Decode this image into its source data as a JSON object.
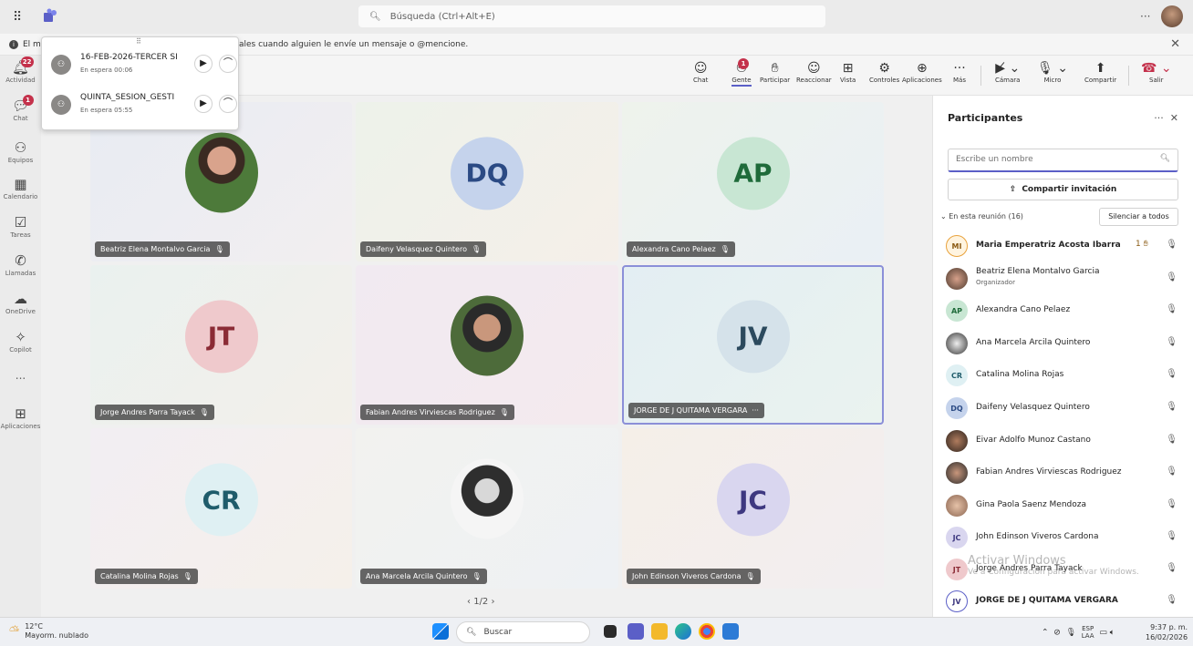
{
  "topbar": {
    "search_placeholder": "Búsqueda (Ctrl+Alt+E)"
  },
  "banner": {
    "text": "El m",
    "text_tail": "ales cuando alguien le envíe un mensaje o @mencione."
  },
  "rail": [
    {
      "label": "Actividad",
      "icon": "bell-icon",
      "badge": "22"
    },
    {
      "label": "Chat",
      "icon": "chat-icon",
      "badge": "1"
    },
    {
      "label": "Equipos",
      "icon": "teams-icon"
    },
    {
      "label": "Calendario",
      "icon": "calendar-icon"
    },
    {
      "label": "Tareas",
      "icon": "tasks-icon"
    },
    {
      "label": "Llamadas",
      "icon": "phone-icon"
    },
    {
      "label": "OneDrive",
      "icon": "cloud-icon"
    },
    {
      "label": "Copilot",
      "icon": "copilot-icon"
    },
    {
      "label": "...",
      "icon": "more-icon"
    },
    {
      "label": "Aplicaciones",
      "icon": "apps-icon"
    }
  ],
  "calls_on_hold": [
    {
      "title": "16-FEB-2026-TERCER SI",
      "status": "En espera  00:06"
    },
    {
      "title": "QUINTA_SESIÓN_GESTI",
      "status": "En espera  05:55"
    }
  ],
  "toolbar": {
    "chat": "Chat",
    "gente": "Gente",
    "gente_badge": "1",
    "participar": "Participar",
    "reaccionar": "Reaccionar",
    "vista": "Vista",
    "controles": "Controles",
    "aplicaciones": "Aplicaciones",
    "mas": "Más",
    "camara": "Cámara",
    "micro": "Micro",
    "compartir": "Compartir",
    "salir": "Salir"
  },
  "tiles": [
    {
      "name": "Beatriz Elena Montalvo Garcia",
      "initials": "",
      "photo": true
    },
    {
      "name": "Daifeny Velasquez Quintero",
      "initials": "DQ"
    },
    {
      "name": "Alexandra Cano Pelaez",
      "initials": "AP"
    },
    {
      "name": "Jorge Andres Parra Tayack",
      "initials": "JT"
    },
    {
      "name": "Fabian Andres Virviescas Rodriguez",
      "initials": "",
      "photo": true
    },
    {
      "name": "JORGE DE J QUITAMA VERGARA",
      "initials": "JV"
    },
    {
      "name": "Catalina Molina Rojas",
      "initials": "CR"
    },
    {
      "name": "Ana Marcela Arcila Quintero",
      "initials": "",
      "photo": true
    },
    {
      "name": "John Edinson Viveros Cardona",
      "initials": "JC"
    }
  ],
  "pager": "1/2",
  "panel": {
    "title": "Participantes",
    "search_placeholder": "Escribe un nombre",
    "share": "Compartir invitación",
    "section": "En esta reunión (16)",
    "mute_all": "Silenciar a todos",
    "people": [
      {
        "initials": "MI",
        "name": "Maria Emperatriz Acosta Ibarra",
        "hand": "1"
      },
      {
        "initials": "",
        "name": "Beatriz Elena Montalvo Garcia",
        "role": "Organizador"
      },
      {
        "initials": "AP",
        "name": "Alexandra Cano Pelaez"
      },
      {
        "initials": "",
        "name": "Ana Marcela Arcila Quintero"
      },
      {
        "initials": "CR",
        "name": "Catalina Molina Rojas"
      },
      {
        "initials": "DQ",
        "name": "Daifeny Velasquez Quintero"
      },
      {
        "initials": "",
        "name": "Eivar Adolfo Munoz Castano"
      },
      {
        "initials": "",
        "name": "Fabian Andres Virviescas Rodriguez"
      },
      {
        "initials": "",
        "name": "Gina Paola Saenz Mendoza"
      },
      {
        "initials": "JC",
        "name": "John Edinson Viveros Cardona"
      },
      {
        "initials": "JT",
        "name": "Jorge Andres Parra Tayack"
      },
      {
        "initials": "JV",
        "name": "JORGE DE J QUITAMA VERGARA"
      }
    ]
  },
  "watermark": {
    "line1": "Activar Windows",
    "line2": "Ve a Configuración para activar Windows."
  },
  "taskbar": {
    "temp": "12°C",
    "weather": "Mayorm. nublado",
    "search": "Buscar",
    "lang1": "ESP",
    "lang2": "LAA",
    "time": "9:37 p. m.",
    "date": "16/02/2026"
  }
}
